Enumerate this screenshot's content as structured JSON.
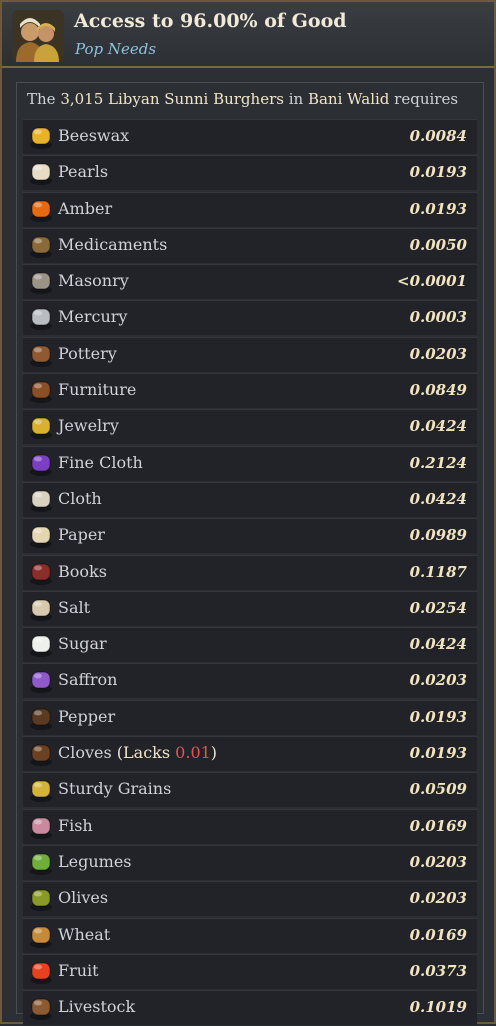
{
  "header": {
    "title": "Access to 96.00% of Good",
    "subtitle": "Pop Needs"
  },
  "requires": {
    "prefix": "The ",
    "count": "3,015",
    "pop": "Libyan Sunni Burghers",
    "in": " in ",
    "location": "Bani Walid",
    "suffix": " requires"
  },
  "goods": [
    {
      "name": "Beeswax",
      "value": "0.0084",
      "icon": "beeswax-icon",
      "color": "#e7b22a"
    },
    {
      "name": "Pearls",
      "value": "0.0193",
      "icon": "pearls-icon",
      "color": "#e8dcc7"
    },
    {
      "name": "Amber",
      "value": "0.0193",
      "icon": "amber-icon",
      "color": "#e46b14"
    },
    {
      "name": "Medicaments",
      "value": "0.0050",
      "icon": "medicaments-icon",
      "color": "#8a6a3a"
    },
    {
      "name": "Masonry",
      "value": "<0.0001",
      "icon": "masonry-icon",
      "color": "#9b9486"
    },
    {
      "name": "Mercury",
      "value": "0.0003",
      "icon": "mercury-icon",
      "color": "#b9bdc2"
    },
    {
      "name": "Pottery",
      "value": "0.0203",
      "icon": "pottery-icon",
      "color": "#8f5a32"
    },
    {
      "name": "Furniture",
      "value": "0.0849",
      "icon": "furniture-icon",
      "color": "#8a4f26"
    },
    {
      "name": "Jewelry",
      "value": "0.0424",
      "icon": "jewelry-icon",
      "color": "#d8b22f"
    },
    {
      "name": "Fine Cloth",
      "value": "0.2124",
      "icon": "fine-cloth-icon",
      "color": "#7b3fc4"
    },
    {
      "name": "Cloth",
      "value": "0.0424",
      "icon": "cloth-icon",
      "color": "#d9d2c3"
    },
    {
      "name": "Paper",
      "value": "0.0989",
      "icon": "paper-icon",
      "color": "#e5d6b2"
    },
    {
      "name": "Books",
      "value": "0.1187",
      "icon": "books-icon",
      "color": "#8b2d2a"
    },
    {
      "name": "Salt",
      "value": "0.0254",
      "icon": "salt-icon",
      "color": "#d8c8ae"
    },
    {
      "name": "Sugar",
      "value": "0.0424",
      "icon": "sugar-icon",
      "color": "#eef1ec"
    },
    {
      "name": "Saffron",
      "value": "0.0203",
      "icon": "saffron-icon",
      "color": "#8e5ac9"
    },
    {
      "name": "Pepper",
      "value": "0.0193",
      "icon": "pepper-icon",
      "color": "#5a3b22"
    },
    {
      "name": "Cloves",
      "lacks_label": "Lacks",
      "lacks_value": "0.01",
      "value": "0.0193",
      "icon": "cloves-icon",
      "color": "#6b4221"
    },
    {
      "name": "Sturdy Grains",
      "value": "0.0509",
      "icon": "sturdy-grains-icon",
      "color": "#d4b33b"
    },
    {
      "name": "Fish",
      "value": "0.0169",
      "icon": "fish-icon",
      "color": "#c98aa0"
    },
    {
      "name": "Legumes",
      "value": "0.0203",
      "icon": "legumes-icon",
      "color": "#6fae3a"
    },
    {
      "name": "Olives",
      "value": "0.0203",
      "icon": "olives-icon",
      "color": "#8a9a2a"
    },
    {
      "name": "Wheat",
      "value": "0.0169",
      "icon": "wheat-icon",
      "color": "#c58b3a"
    },
    {
      "name": "Fruit",
      "value": "0.0373",
      "icon": "fruit-icon",
      "color": "#e6421f"
    },
    {
      "name": "Livestock",
      "value": "0.1019",
      "icon": "livestock-icon",
      "color": "#8a5a32"
    }
  ]
}
